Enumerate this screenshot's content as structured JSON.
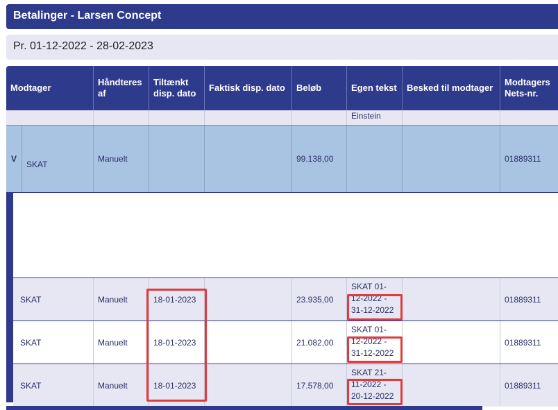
{
  "page": {
    "title": "Betalinger - Larsen Concept",
    "period": "Pr. 01-12-2022 - 28-02-2023"
  },
  "columns": [
    "Modtager",
    "Håndteres af",
    "Tiltænkt disp. dato",
    "Faktisk disp. dato",
    "Beløb",
    "Egen tekst",
    "Besked til modtager",
    "Modtagers Nets-nr."
  ],
  "subrow": {
    "egen_tekst": "Einstein"
  },
  "group": {
    "toggle": "V",
    "modtager": "SKAT",
    "haandteres_af": "Manuelt",
    "beloeb": "99.138,00",
    "nets_nr": "01889311"
  },
  "rows": [
    {
      "modtager": "SKAT",
      "haandteres_af": "Manuelt",
      "tiltaenkt_dato": "18-01-2023",
      "beloeb": "23.935,00",
      "egen_tekst_1": "SKAT 01-",
      "egen_tekst_2": "12-2022 -",
      "egen_tekst_3": "31-12-2022",
      "nets_nr": "01889311"
    },
    {
      "modtager": "SKAT",
      "haandteres_af": "Manuelt",
      "tiltaenkt_dato": "18-01-2023",
      "beloeb": "21.082,00",
      "egen_tekst_1": "SKAT 01-",
      "egen_tekst_2": "12-2022 -",
      "egen_tekst_3": "31-12-2022",
      "nets_nr": "01889311"
    },
    {
      "modtager": "SKAT",
      "haandteres_af": "Manuelt",
      "tiltaenkt_dato": "18-01-2023",
      "beloeb": "17.578,00",
      "egen_tekst_1": "SKAT 21-",
      "egen_tekst_2": "11-2022 -",
      "egen_tekst_3": "20-12-2022",
      "nets_nr": "01889311"
    }
  ],
  "colors": {
    "header": "#2e3a8c",
    "group_row": "#a9c3e3",
    "lavender_row": "#e6e7f3",
    "highlight_box": "#e03c3c"
  }
}
